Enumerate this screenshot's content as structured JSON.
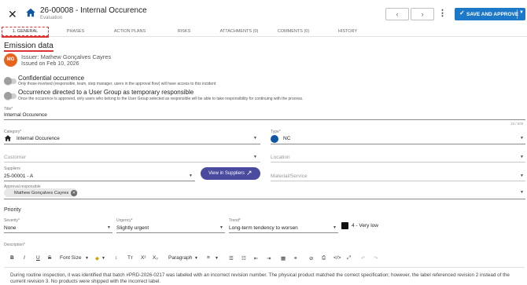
{
  "header": {
    "title": "26-00008 - Internal Occurence",
    "subtitle": "Evaluation",
    "prev_icon": "chevron-left",
    "next_icon": "chevron-right",
    "save_label": "SAVE AND APPROVE",
    "accent": "#1e78c8"
  },
  "tabs": [
    {
      "label": "1. GENERAL",
      "active": true
    },
    {
      "label": "PHASES"
    },
    {
      "label": "ACTION PLANS"
    },
    {
      "label": "RISKS"
    },
    {
      "label": "ATTACHMENTS (0)"
    },
    {
      "label": "COMMENTS (0)"
    },
    {
      "label": "HISTORY"
    }
  ],
  "section_title": "Emission data",
  "issuer": {
    "initials": "MG",
    "issuer_text": "Issuer: Mathew Gonçalves Cayres",
    "issued_text": "Issued on Feb 10, 2026",
    "avatar_color": "#e8641e"
  },
  "toggles": [
    {
      "title": "Confidential occurrence",
      "desc": "Only those involved (responsible, team, step manager, users in the approval flow) will have access to this incident",
      "on": false
    },
    {
      "title": "Occurrence directed to a User Group as temporary responsible",
      "desc": "Once the occurence is approved, only users who belong to the User Group selected as responsible will be able to take responsibility for continuing with the process.",
      "on": false
    }
  ],
  "fields": {
    "title": {
      "label": "Title*",
      "value": "Internal Occurence",
      "counter": "18 / 500"
    },
    "category": {
      "label": "Category*",
      "value": "Internal Occurence"
    },
    "type": {
      "label": "Type*",
      "value": "NC",
      "color": "#0b57a4"
    },
    "customer": {
      "placeholder": "Customer"
    },
    "location": {
      "placeholder": "Location"
    },
    "suppliers": {
      "label": "Suppliers",
      "value": "25-00001 - A"
    },
    "view_suppliers": "View in Suppliers",
    "material": {
      "placeholder": "Material/Service"
    },
    "approval": {
      "label": "Approval responsible",
      "chip": "Mathew Gonçalves Cayres"
    }
  },
  "priority": {
    "title": "Priority",
    "severity": {
      "label": "Severity*",
      "value": "None"
    },
    "urgency": {
      "label": "Urgency*",
      "value": "Slightly urgent"
    },
    "trend": {
      "label": "Trend*",
      "value": "Long-term tendency to worsen"
    },
    "result": "4 - Very low"
  },
  "description": {
    "label": "Description*",
    "toolbar": {
      "bold": "B",
      "italic": "I",
      "underline": "U",
      "strike": "S",
      "font_size": "Font Size",
      "paragraph": "Paragraph",
      "superscript": "X²",
      "subscript": "X₂"
    },
    "text": "During routine inspection, it was identified that batch #PRD-2026-0217 was labeled with an incorrect revision number. The physical product matched the correct specification; however, the label referenced revision 2 instead of the current revision 3. No products were shipped with the incorrect label."
  }
}
